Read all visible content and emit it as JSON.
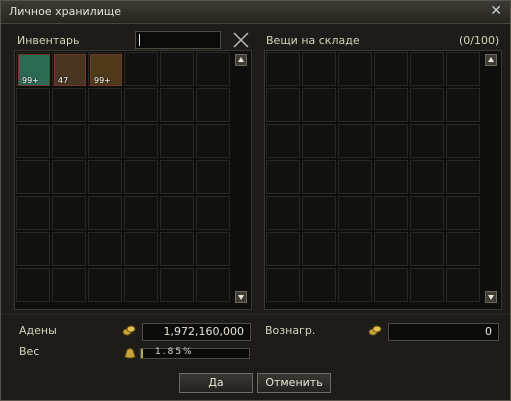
{
  "window": {
    "title": "Личное хранилище",
    "close_glyph": "✕"
  },
  "inventory": {
    "label": "Инвентарь",
    "search_value": "",
    "clear_icon": "x-icon",
    "items": [
      {
        "name": "green-orb-item",
        "qty": "99+",
        "bg": "#2d6a54"
      },
      {
        "name": "golden-crystal-item",
        "qty": "47",
        "bg": "#4a3422"
      },
      {
        "name": "gold-ore-item",
        "qty": "99+",
        "bg": "#4f3a1b"
      }
    ]
  },
  "warehouse": {
    "label": "Вещи на складе",
    "count": "(0/100)"
  },
  "adena": {
    "label": "Адены",
    "value": "1,972,160,000",
    "icon": "coins-icon"
  },
  "weight": {
    "label": "Вес",
    "value": "1.85%",
    "percent": 1.85,
    "icon": "weight-bag-icon"
  },
  "reward": {
    "label": "Вознагр.",
    "value": "0",
    "icon": "coins-icon"
  },
  "buttons": {
    "ok": "Да",
    "cancel": "Отменить"
  },
  "colors": {
    "accent": "#b7a153",
    "window_bg": "#1d1c19",
    "slot_bg": "#121211"
  }
}
